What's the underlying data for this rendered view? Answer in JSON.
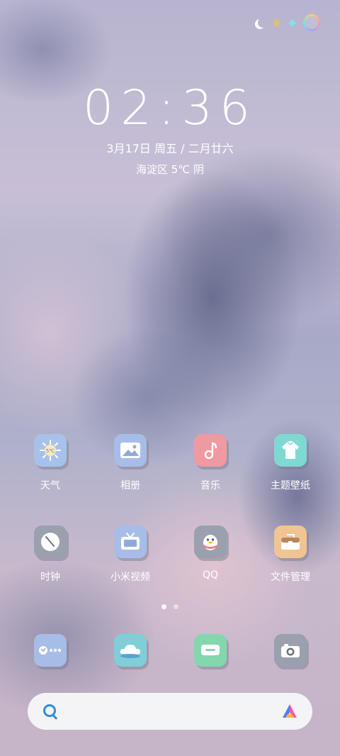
{
  "status_bar": {
    "icons": [
      "moon-icon",
      "crown-icon",
      "gem-icon",
      "theme-ring-icon"
    ]
  },
  "lockscreen": {
    "time": "02:36",
    "date": "3月17日 周五 / 二月廿六",
    "weather": "海淀区 5℃ 阴"
  },
  "apps_row1": [
    {
      "label": "天气",
      "icon": "weather-icon",
      "badge": "5℃",
      "color": "#a9c1ea"
    },
    {
      "label": "相册",
      "icon": "gallery-icon",
      "color": "#a7bde8"
    },
    {
      "label": "音乐",
      "icon": "music-icon",
      "color": "#ee9aa0"
    },
    {
      "label": "主题壁纸",
      "icon": "theme-icon",
      "color": "#7fd9d3"
    }
  ],
  "apps_row2": [
    {
      "label": "时钟",
      "icon": "clock-icon",
      "color": "#9aa0ad"
    },
    {
      "label": "小米视频",
      "icon": "video-icon",
      "color": "#a7bde8"
    },
    {
      "label": "QQ",
      "icon": "qq-icon",
      "color": "#9aa0ad"
    },
    {
      "label": "文件管理",
      "icon": "folder-icon",
      "color": "#f1c593"
    }
  ],
  "dock": [
    {
      "icon": "phone-icon",
      "color": "#a7bde8"
    },
    {
      "icon": "browser-icon",
      "color": "#7fcfd8"
    },
    {
      "icon": "message-icon",
      "color": "#83d7ad"
    },
    {
      "icon": "camera-icon",
      "color": "#9aa0ad"
    }
  ],
  "page_indicator": {
    "current": 1,
    "total": 2
  },
  "search_bar": {
    "icon": "search-icon",
    "assistant_icon": "assistant-icon"
  }
}
